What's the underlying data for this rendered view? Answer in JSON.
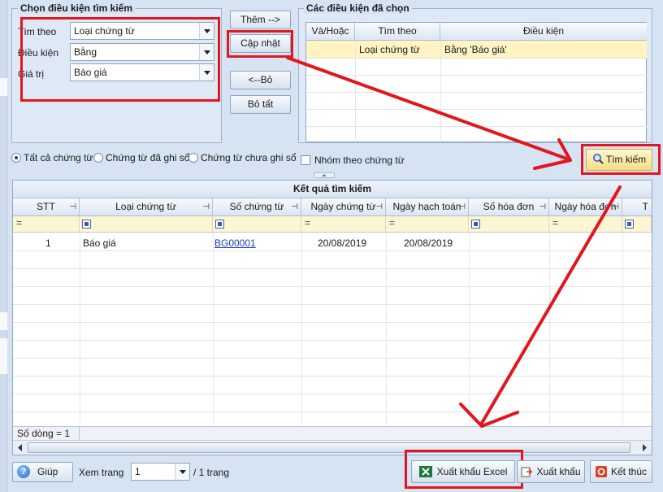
{
  "search_conditions": {
    "title": "Chọn điều kiện tìm kiếm",
    "search_by_label": "Tìm theo",
    "search_by_value": "Loại chứng từ",
    "condition_label": "Điều kiện",
    "condition_value": "Bằng",
    "value_label": "Giá trị",
    "value_value": "Báo giá"
  },
  "actions": {
    "add_label": "Thêm -->",
    "update_label": "Cập nhật",
    "remove_label": "<--Bỏ",
    "remove_all_label": "Bỏ tất"
  },
  "selected_conditions": {
    "title": "Các điều kiện đã chọn",
    "headers": [
      "Và/Hoặc",
      "Tìm theo",
      "Điều kiện"
    ],
    "rows": [
      {
        "andor": "",
        "field": "Loại chứng từ",
        "condition": "Bằng 'Báo giá'"
      }
    ]
  },
  "filters": {
    "all_docs": "Tất cả chứng từ",
    "posted_docs": "Chứng từ đã ghi sổ",
    "unposted_docs": "Chứng từ chưa ghi sổ",
    "group_by_doc": "Nhóm theo chứng từ"
  },
  "search_button_label": "Tìm kiếm",
  "results": {
    "title": "Kết quả tìm kiếm",
    "headers": [
      "STT",
      "Loại chứng từ",
      "Số chứng từ",
      "Ngày chứng từ",
      "Ngày hạch toán",
      "Số hóa đơn",
      "Ngày hóa đơn",
      "T"
    ],
    "rows": [
      {
        "stt": "1",
        "doc_type": "Báo giá",
        "doc_no": "BG00001",
        "doc_date": "20/08/2019",
        "post_date": "20/08/2019",
        "invoice_no": "",
        "invoice_date": ""
      }
    ],
    "row_count": "Số dòng = 1"
  },
  "footer": {
    "help_label": "Giúp",
    "view_page_label": "Xem trang",
    "page_value": "1",
    "page_total": "/ 1 trang",
    "export_excel_label": "Xuất khẩu Excel",
    "export_label": "Xuất khẩu",
    "finish_label": "Kết thúc"
  }
}
